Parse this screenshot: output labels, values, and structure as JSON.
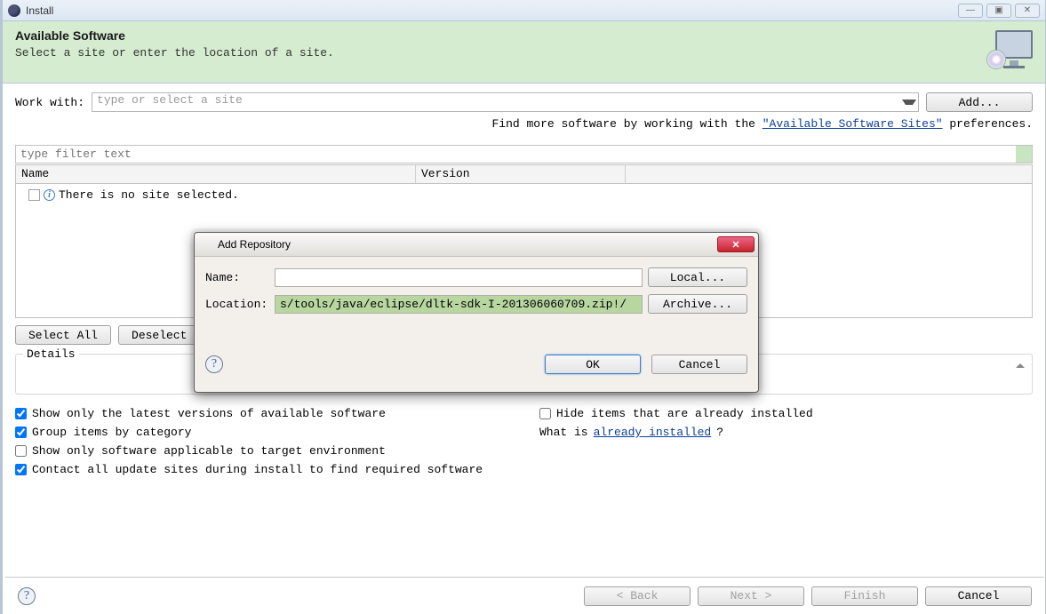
{
  "window": {
    "title": "Install",
    "win_buttons": {
      "minimize": "—",
      "maximize": "▣",
      "close": "✕"
    }
  },
  "header": {
    "title": "Available Software",
    "subtitle": "Select a site or enter the location of a site."
  },
  "workwith": {
    "label": "Work with:",
    "placeholder": "type or select a site",
    "add_btn": "Add..."
  },
  "hint": {
    "prefix": "Find more software by working with the ",
    "link": "\"Available Software Sites\"",
    "suffix": " preferences."
  },
  "filter": {
    "placeholder": "type filter text"
  },
  "columns": {
    "name": "Name",
    "version": "Version"
  },
  "tree": {
    "empty": "There is no site selected."
  },
  "sel": {
    "select_all": "Select All",
    "deselect_all": "Deselect All"
  },
  "details": {
    "legend": "Details"
  },
  "options": {
    "show_latest": {
      "label": "Show only the latest versions of available software",
      "checked": true
    },
    "group_category": {
      "label": "Group items by category",
      "checked": true
    },
    "applicable_target": {
      "label": "Show only software applicable to target environment",
      "checked": false
    },
    "contact_all": {
      "label": "Contact all update sites during install to find required software",
      "checked": true
    },
    "hide_installed": {
      "label": "Hide items that are already installed",
      "checked": false
    },
    "whatis_prefix": "What is ",
    "whatis_link": "already installed",
    "whatis_suffix": "?"
  },
  "footer": {
    "back": "< Back",
    "next": "Next >",
    "finish": "Finish",
    "cancel": "Cancel"
  },
  "dialog": {
    "title": "Add Repository",
    "name_label": "Name:",
    "name_value": "",
    "location_label": "Location:",
    "location_value": "s/tools/java/eclipse/dltk-sdk-I-201306060709.zip!/",
    "local_btn": "Local...",
    "archive_btn": "Archive...",
    "ok": "OK",
    "cancel": "Cancel"
  }
}
